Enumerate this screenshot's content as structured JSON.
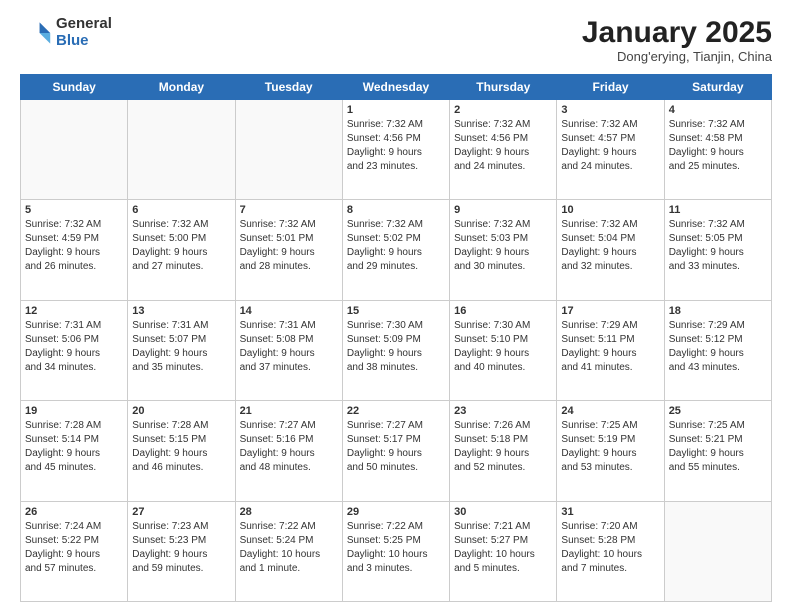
{
  "header": {
    "logo_general": "General",
    "logo_blue": "Blue",
    "month_title": "January 2025",
    "location": "Dong'erying, Tianjin, China"
  },
  "days_of_week": [
    "Sunday",
    "Monday",
    "Tuesday",
    "Wednesday",
    "Thursday",
    "Friday",
    "Saturday"
  ],
  "weeks": [
    [
      {
        "day": "",
        "info": ""
      },
      {
        "day": "",
        "info": ""
      },
      {
        "day": "",
        "info": ""
      },
      {
        "day": "1",
        "info": "Sunrise: 7:32 AM\nSunset: 4:56 PM\nDaylight: 9 hours\nand 23 minutes."
      },
      {
        "day": "2",
        "info": "Sunrise: 7:32 AM\nSunset: 4:56 PM\nDaylight: 9 hours\nand 24 minutes."
      },
      {
        "day": "3",
        "info": "Sunrise: 7:32 AM\nSunset: 4:57 PM\nDaylight: 9 hours\nand 24 minutes."
      },
      {
        "day": "4",
        "info": "Sunrise: 7:32 AM\nSunset: 4:58 PM\nDaylight: 9 hours\nand 25 minutes."
      }
    ],
    [
      {
        "day": "5",
        "info": "Sunrise: 7:32 AM\nSunset: 4:59 PM\nDaylight: 9 hours\nand 26 minutes."
      },
      {
        "day": "6",
        "info": "Sunrise: 7:32 AM\nSunset: 5:00 PM\nDaylight: 9 hours\nand 27 minutes."
      },
      {
        "day": "7",
        "info": "Sunrise: 7:32 AM\nSunset: 5:01 PM\nDaylight: 9 hours\nand 28 minutes."
      },
      {
        "day": "8",
        "info": "Sunrise: 7:32 AM\nSunset: 5:02 PM\nDaylight: 9 hours\nand 29 minutes."
      },
      {
        "day": "9",
        "info": "Sunrise: 7:32 AM\nSunset: 5:03 PM\nDaylight: 9 hours\nand 30 minutes."
      },
      {
        "day": "10",
        "info": "Sunrise: 7:32 AM\nSunset: 5:04 PM\nDaylight: 9 hours\nand 32 minutes."
      },
      {
        "day": "11",
        "info": "Sunrise: 7:32 AM\nSunset: 5:05 PM\nDaylight: 9 hours\nand 33 minutes."
      }
    ],
    [
      {
        "day": "12",
        "info": "Sunrise: 7:31 AM\nSunset: 5:06 PM\nDaylight: 9 hours\nand 34 minutes."
      },
      {
        "day": "13",
        "info": "Sunrise: 7:31 AM\nSunset: 5:07 PM\nDaylight: 9 hours\nand 35 minutes."
      },
      {
        "day": "14",
        "info": "Sunrise: 7:31 AM\nSunset: 5:08 PM\nDaylight: 9 hours\nand 37 minutes."
      },
      {
        "day": "15",
        "info": "Sunrise: 7:30 AM\nSunset: 5:09 PM\nDaylight: 9 hours\nand 38 minutes."
      },
      {
        "day": "16",
        "info": "Sunrise: 7:30 AM\nSunset: 5:10 PM\nDaylight: 9 hours\nand 40 minutes."
      },
      {
        "day": "17",
        "info": "Sunrise: 7:29 AM\nSunset: 5:11 PM\nDaylight: 9 hours\nand 41 minutes."
      },
      {
        "day": "18",
        "info": "Sunrise: 7:29 AM\nSunset: 5:12 PM\nDaylight: 9 hours\nand 43 minutes."
      }
    ],
    [
      {
        "day": "19",
        "info": "Sunrise: 7:28 AM\nSunset: 5:14 PM\nDaylight: 9 hours\nand 45 minutes."
      },
      {
        "day": "20",
        "info": "Sunrise: 7:28 AM\nSunset: 5:15 PM\nDaylight: 9 hours\nand 46 minutes."
      },
      {
        "day": "21",
        "info": "Sunrise: 7:27 AM\nSunset: 5:16 PM\nDaylight: 9 hours\nand 48 minutes."
      },
      {
        "day": "22",
        "info": "Sunrise: 7:27 AM\nSunset: 5:17 PM\nDaylight: 9 hours\nand 50 minutes."
      },
      {
        "day": "23",
        "info": "Sunrise: 7:26 AM\nSunset: 5:18 PM\nDaylight: 9 hours\nand 52 minutes."
      },
      {
        "day": "24",
        "info": "Sunrise: 7:25 AM\nSunset: 5:19 PM\nDaylight: 9 hours\nand 53 minutes."
      },
      {
        "day": "25",
        "info": "Sunrise: 7:25 AM\nSunset: 5:21 PM\nDaylight: 9 hours\nand 55 minutes."
      }
    ],
    [
      {
        "day": "26",
        "info": "Sunrise: 7:24 AM\nSunset: 5:22 PM\nDaylight: 9 hours\nand 57 minutes."
      },
      {
        "day": "27",
        "info": "Sunrise: 7:23 AM\nSunset: 5:23 PM\nDaylight: 9 hours\nand 59 minutes."
      },
      {
        "day": "28",
        "info": "Sunrise: 7:22 AM\nSunset: 5:24 PM\nDaylight: 10 hours\nand 1 minute."
      },
      {
        "day": "29",
        "info": "Sunrise: 7:22 AM\nSunset: 5:25 PM\nDaylight: 10 hours\nand 3 minutes."
      },
      {
        "day": "30",
        "info": "Sunrise: 7:21 AM\nSunset: 5:27 PM\nDaylight: 10 hours\nand 5 minutes."
      },
      {
        "day": "31",
        "info": "Sunrise: 7:20 AM\nSunset: 5:28 PM\nDaylight: 10 hours\nand 7 minutes."
      },
      {
        "day": "",
        "info": ""
      }
    ]
  ]
}
